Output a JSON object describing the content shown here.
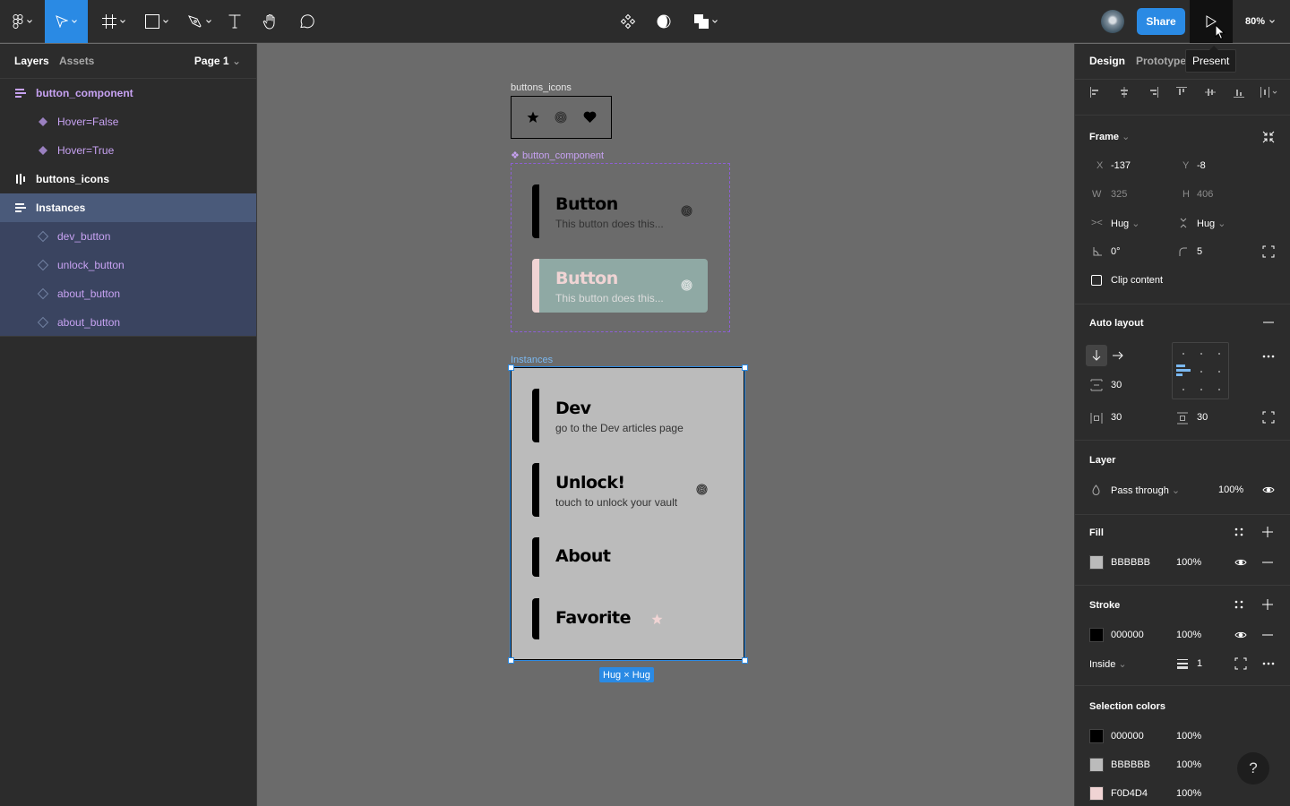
{
  "toolbar": {
    "tools": [
      {
        "name": "main-menu",
        "icon": "figma-logo-icon"
      },
      {
        "name": "move",
        "icon": "cursor-arrow-icon",
        "active": true
      },
      {
        "name": "frame",
        "icon": "frame-hash-icon"
      },
      {
        "name": "shape",
        "icon": "rectangle-icon"
      },
      {
        "name": "pen",
        "icon": "pen-icon"
      },
      {
        "name": "text",
        "icon": "text-icon"
      },
      {
        "name": "hand",
        "icon": "hand-icon"
      },
      {
        "name": "comment",
        "icon": "comment-icon"
      }
    ],
    "center_tools": [
      "component-icon",
      "contrast-icon",
      "boolean-icon"
    ],
    "share_label": "Share",
    "present_tooltip": "Present",
    "zoom_level": "80%"
  },
  "left_panel": {
    "tabs": [
      "Layers",
      "Assets"
    ],
    "active_tab": "Layers",
    "page": "Page 1",
    "layers": [
      {
        "label": "button_component",
        "type": "component-set",
        "depth": 0
      },
      {
        "label": "Hover=False",
        "type": "variant",
        "depth": 1
      },
      {
        "label": "Hover=True",
        "type": "variant",
        "depth": 1
      },
      {
        "label": "buttons_icons",
        "type": "auto-layout-horizontal",
        "depth": 0
      },
      {
        "label": "Instances",
        "type": "auto-layout-vertical",
        "depth": 0,
        "selected": true
      },
      {
        "label": "dev_button",
        "type": "instance",
        "depth": 1
      },
      {
        "label": "unlock_button",
        "type": "instance",
        "depth": 1
      },
      {
        "label": "about_button",
        "type": "instance",
        "depth": 1
      },
      {
        "label": "about_button",
        "type": "instance",
        "depth": 1
      }
    ]
  },
  "canvas": {
    "icons_frame_label": "buttons_icons",
    "icons": [
      "star-icon",
      "fingerprint-icon",
      "heart-icon"
    ],
    "component_label": "button_component",
    "variants": [
      {
        "title": "Button",
        "subtitle": "This button does this...",
        "icon": "fingerprint-icon",
        "hover": false
      },
      {
        "title": "Button",
        "subtitle": "This button does this...",
        "icon": "fingerprint-icon",
        "hover": true
      }
    ],
    "instances_label": "Instances",
    "instances": [
      {
        "title": "Dev",
        "subtitle": "go to the Dev articles page",
        "icon": ""
      },
      {
        "title": "Unlock!",
        "subtitle": "touch to unlock your vault",
        "icon": "fingerprint-icon"
      },
      {
        "title": "About",
        "subtitle": "",
        "icon": ""
      },
      {
        "title": "Favorite",
        "subtitle": "",
        "icon": "star-icon"
      }
    ],
    "size_tag": "Hug × Hug"
  },
  "right_panel": {
    "tabs": [
      "Design",
      "Prototype"
    ],
    "active_tab": "Design",
    "frame": {
      "title": "Frame",
      "x_label": "X",
      "x": "-137",
      "y_label": "Y",
      "y": "-8",
      "w_label": "W",
      "w": "325",
      "h_label": "H",
      "h": "406",
      "h_sizing": "Hug",
      "v_sizing": "Hug",
      "rotation": "0°",
      "radius": "5",
      "clip_content_label": "Clip content",
      "clip_content": false
    },
    "auto_layout": {
      "title": "Auto layout",
      "direction": "vertical",
      "gap": "30",
      "padding_h": "30",
      "padding_v": "30"
    },
    "layer": {
      "title": "Layer",
      "blend": "Pass through",
      "opacity": "100%"
    },
    "fill": {
      "title": "Fill",
      "color": "BBBBBB",
      "swatch": "#bbbbbb",
      "opacity": "100%"
    },
    "stroke": {
      "title": "Stroke",
      "color": "000000",
      "swatch": "#000000",
      "opacity": "100%",
      "position": "Inside",
      "weight": "1"
    },
    "selection_colors": {
      "title": "Selection colors",
      "items": [
        {
          "hex": "000000",
          "swatch": "#000000",
          "opacity": "100%"
        },
        {
          "hex": "BBBBBB",
          "swatch": "#bbbbbb",
          "opacity": "100%"
        },
        {
          "hex": "F0D4D4",
          "swatch": "#f0d4d4",
          "opacity": "100%"
        }
      ]
    },
    "help_label": "?"
  },
  "colors": {
    "accent": "#2a8ae4",
    "component_purple": "#c7a2f2",
    "hover_bg": "#8fa9a4",
    "pink": "#f0d4d4"
  }
}
